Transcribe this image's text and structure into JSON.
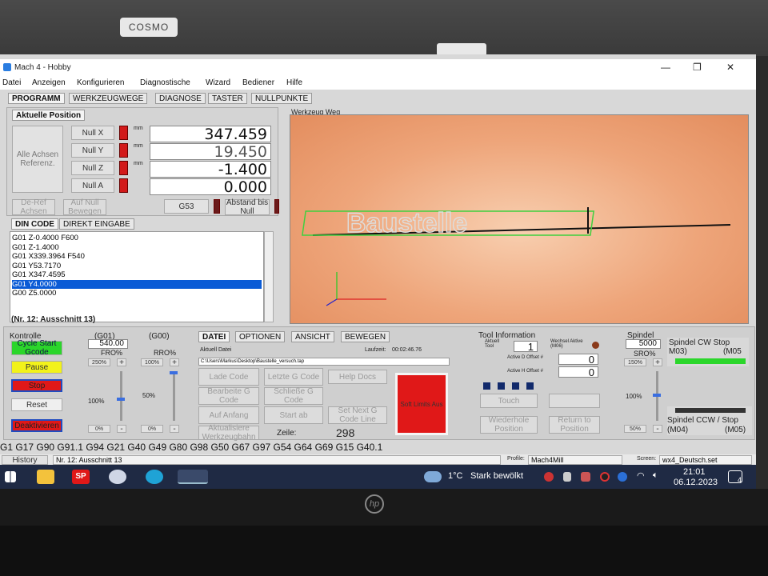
{
  "window": {
    "title": "Mach 4 - Hobby"
  },
  "background": {
    "logo_text": "COSMO"
  },
  "menu": [
    "Datei",
    "Anzeigen",
    "Konfigurieren",
    "Diagnostische",
    "Wizard",
    "Bediener",
    "Hilfe"
  ],
  "tabs": [
    "PROGRAMM",
    "WERKZEUGWEGE",
    "DIAGNOSE",
    "TASTER",
    "NULLPUNKTE"
  ],
  "position": {
    "header": "Aktuelle Position",
    "all_ref_label": "Alle Achsen Referenz.",
    "axes": [
      {
        "button": "Null X",
        "unit": "mm",
        "value": "347.459"
      },
      {
        "button": "Null Y",
        "unit": "mm",
        "value": "19.450"
      },
      {
        "button": "Null Z",
        "unit": "mm",
        "value": "-1.400"
      },
      {
        "button": "Null A",
        "unit": "",
        "value": "0.000"
      }
    ],
    "deref": "De-Ref Achsen",
    "auf_null": "Auf Null Bewegen",
    "g53": "G53",
    "abstand": "Abstand bis Null"
  },
  "code_tabs": [
    "DIN CODE",
    "DIREKT EINGABE"
  ],
  "gcode_lines": [
    "G01 Z-0.4000 F600",
    "G01 Z-1.4000",
    "G01 X339.3964 F540",
    "G01 Y53.7170",
    "G01 X347.4595",
    "G01 Y4.0000",
    "G00 Z5.0000"
  ],
  "gcode_selected_index": 5,
  "current_line_label": "(Nr. 12: Ausschnitt 13)",
  "toolpath": {
    "header": "Werkzeug Weg",
    "text": "Baustelle"
  },
  "kontrolle": {
    "header": "Kontrolle",
    "cycle_start": "Cycle Start Gcode",
    "pause": "Pause",
    "stop": "Stop",
    "reset": "Reset",
    "deaktivieren": "Deaktivieren"
  },
  "feed": {
    "g01_label": "(G01)",
    "g00_label": "(G00)",
    "value": "540.00",
    "fro_label": "FRO%",
    "rro_label": "RRO%",
    "fro_top": "250%",
    "rro_top": "100%",
    "fro_mid": "100%",
    "rro_mid": "50%",
    "fro_bottom": "0%",
    "rro_bottom": "0%"
  },
  "file_tabs": [
    "DATEI",
    "OPTIONEN",
    "ANSICHT",
    "BEWEGEN"
  ],
  "file": {
    "current_label": "Aktuell Datei",
    "laufzeit_label": "Laufzeit:",
    "laufzeit": "00:02:46.76",
    "path": "C:\\Users\\Markus\\Desktop\\Baustelle_versuch.tap",
    "lade": "Lade Code",
    "letzte": "Letzte G Code",
    "help": "Help Docs",
    "bearbeite": "Bearbeite G Code",
    "schliesse": "Schließe G Code",
    "auf_anfang": "Auf Anfang",
    "start_ab": "Start ab",
    "set_next": "Set Next G Code Line",
    "aktualisiere": "Aktualisiere Werkzeugbahn",
    "zeile_label": "Zeile:",
    "zeile": "298",
    "soft_limits": "Soft Limits Aus"
  },
  "tool": {
    "header": "Tool Information",
    "aktuell_label": "Aktuell Tool",
    "aktuell": "1",
    "wechsel_label": "Wechsel Aktive (M06)",
    "d_offset_label": "Active D Offset #",
    "d_offset": "0",
    "h_offset_label": "Active H Offset #",
    "h_offset": "0",
    "touch": "Touch",
    "wiederhole": "Wiederhole Position",
    "return": "Return to Position"
  },
  "spindle": {
    "header": "Spindel",
    "value": "5000",
    "sro_label": "SRO%",
    "cw": "Spindel CW Stop",
    "m03": "M03)",
    "m05a": "(M05",
    "ccw": "Spindel CCW / Stop",
    "m04": "(M04)",
    "m05b": "(M05)",
    "top": "150%",
    "mid": "100%",
    "bottom": "50%"
  },
  "modal_line": "G1 G17 G90 G91.1 G94 G21 G40 G49 G80 G98 G50 G67 G97 G54 G64 G69 G15 G40.1",
  "statusbar": {
    "history": "History",
    "message": "Nr. 12: Ausschnitt 13",
    "profile_label": "Profile:",
    "profile": "Mach4Mill",
    "screen_label": "Screen:",
    "screen": "wx4_Deutsch.set"
  },
  "taskbar": {
    "weather_temp": "1°C",
    "weather_text": "Stark bewölkt",
    "time": "21:01",
    "date": "06.12.2023",
    "notifications": "4",
    "sp_label": "SP"
  },
  "colors": {
    "accent": "#0a5bd6",
    "green": "#2bd62b",
    "yellow": "#f2f21a",
    "red": "#e01818"
  }
}
